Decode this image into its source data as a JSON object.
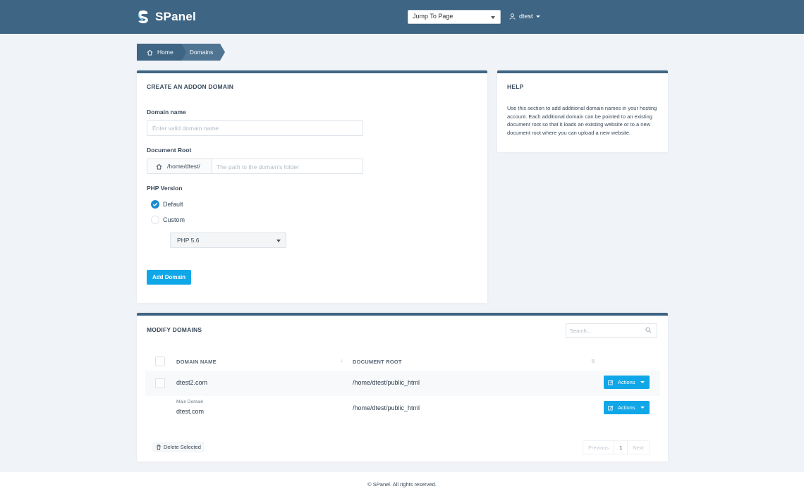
{
  "brand": {
    "name": "SPanel"
  },
  "header": {
    "jump_to_page": "Jump To Page",
    "username": "dtest"
  },
  "breadcrumb": {
    "home": "Home",
    "current": "Domains"
  },
  "create_form": {
    "title": "CREATE AN ADDON DOMAIN",
    "domain_name_label": "Domain name",
    "domain_name_placeholder": "Enter valid domain name",
    "document_root_label": "Document Root",
    "document_root_prefix": "/home/dtest/",
    "document_root_placeholder": "The path to the domain's folder",
    "php_version_label": "PHP Version",
    "php_options": [
      {
        "label": "Default",
        "selected": true
      },
      {
        "label": "Custom",
        "selected": false
      }
    ],
    "php_select_value": "PHP 5.6",
    "submit_label": "Add Domain"
  },
  "help": {
    "title": "HELP",
    "text": "Use this section to add additional domain names in your hosting account. Each additional domain can be pointed to an existing document root so that it loads an existing website or to a new document root where you can upload a new website."
  },
  "modify": {
    "title": "MODIFY DOMAINS",
    "search_placeholder": "Search...",
    "columns": {
      "domain_name": "DOMAIN NAME",
      "document_root": "DOCUMENT ROOT",
      "sort_indicator": "↓",
      "sort_indicator_2": "⇅"
    },
    "rows": [
      {
        "sublabel": "",
        "domain": "dtest2.com",
        "root": "/home/dtest/public_html",
        "action": "Actions"
      },
      {
        "sublabel": "Main Domain",
        "domain": "dtest.com",
        "root": "/home/dtest/public_html",
        "action": "Actions"
      }
    ],
    "delete_label": "Delete Selected",
    "pagination": {
      "prev": "Previous",
      "page": "1",
      "next": "Next"
    }
  },
  "footer": {
    "text": "© SPanel. All rights reserved."
  },
  "colors": {
    "header_bg": "#3e6583",
    "accent": "#10a7e8",
    "radio_checked": "#1b8ad3",
    "page_bg": "#f0f3f7"
  }
}
